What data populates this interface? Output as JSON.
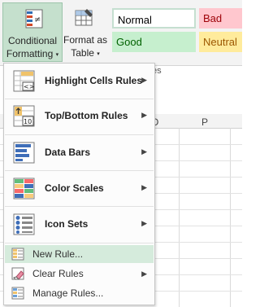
{
  "ribbon": {
    "conditional_formatting": {
      "line1": "Conditional",
      "line2": "Formatting",
      "caret": "▾"
    },
    "format_as_table": {
      "line1": "Format as",
      "line2": "Table",
      "caret": "▾"
    },
    "styles": {
      "normal": "Normal",
      "bad": "Bad",
      "good": "Good",
      "neutral": "Neutral"
    },
    "group_label_fragment": "es"
  },
  "sheet": {
    "column_headers": [
      "O",
      "P"
    ]
  },
  "menu": {
    "items": [
      {
        "label": "Highlight Cells Rules",
        "icon": "highlight-cells-icon",
        "submenu": true
      },
      {
        "label": "Top/Bottom Rules",
        "icon": "top-bottom-icon",
        "submenu": true
      },
      {
        "label": "Data Bars",
        "icon": "data-bars-icon",
        "submenu": true
      },
      {
        "label": "Color Scales",
        "icon": "color-scales-icon",
        "submenu": true
      },
      {
        "label": "Icon Sets",
        "icon": "icon-sets-icon",
        "submenu": true
      }
    ],
    "actions": [
      {
        "label": "New Rule...",
        "icon": "new-rule-icon",
        "submenu": false,
        "highlighted": true
      },
      {
        "label": "Clear Rules",
        "icon": "clear-rules-icon",
        "submenu": true
      },
      {
        "label": "Manage Rules...",
        "icon": "manage-rules-icon",
        "submenu": false
      }
    ],
    "submenu_arrow": "▶"
  },
  "colors": {
    "accent_green": "#c5e0cd",
    "menu_hover": "#d5ebdc",
    "bad_bg": "#ffc7ce",
    "good_bg": "#c6efce",
    "neutral_bg": "#ffeb9c"
  }
}
